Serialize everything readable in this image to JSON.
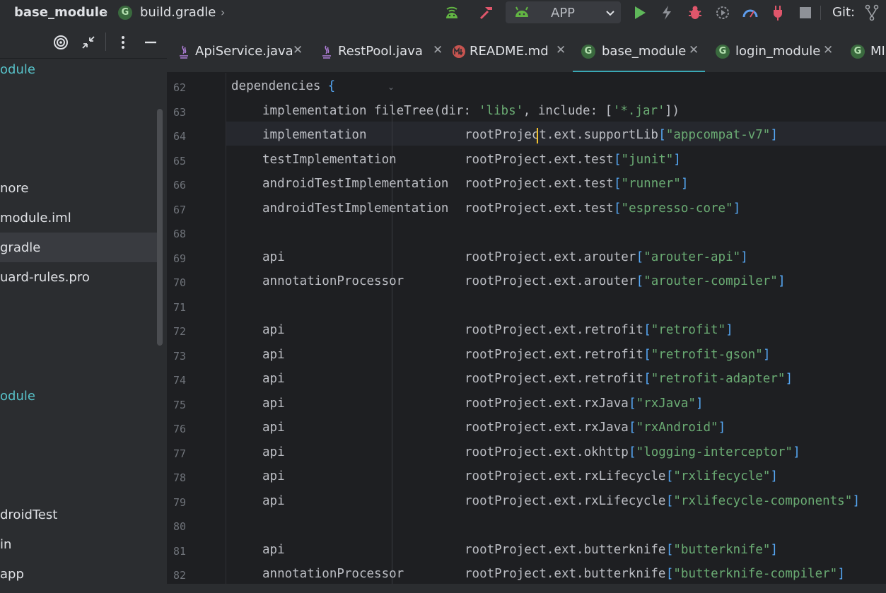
{
  "toolbar": {
    "breadcrumb_module": "base_module",
    "breadcrumb_file": "build.gradle",
    "run_config": "APP",
    "git_label": "Git:"
  },
  "project_panel": {
    "items": [
      {
        "label": "odule",
        "type": "module"
      },
      {
        "label": "nore",
        "type": "file"
      },
      {
        "label": "module.iml",
        "type": "file"
      },
      {
        "label": "gradle",
        "type": "file"
      },
      {
        "label": "uard-rules.pro",
        "type": "file"
      },
      {
        "label": "odule",
        "type": "module"
      },
      {
        "label": "droidTest",
        "type": "folder"
      },
      {
        "label": "in",
        "type": "folder"
      },
      {
        "label": "app",
        "type": "folder"
      }
    ]
  },
  "tabs": [
    {
      "label": "ApiService.java",
      "icon": "java-icon"
    },
    {
      "label": "RestPool.java",
      "icon": "java-icon"
    },
    {
      "label": "README.md",
      "icon": "markdown-icon"
    },
    {
      "label": "base_module",
      "icon": "gradle-icon",
      "active": true
    },
    {
      "label": "login_module",
      "icon": "gradle-icon"
    },
    {
      "label": "MI",
      "icon": "gradle-icon"
    }
  ],
  "editor": {
    "lines": [
      {
        "num": "62",
        "decl": "dependencies",
        "value": "",
        "key": "",
        "extra": "{"
      },
      {
        "num": "63",
        "decl": "implementation fileTree(dir: 'libs', include: ['*.jar'])",
        "value": "",
        "key": ""
      },
      {
        "num": "64",
        "decl": "implementation",
        "value": "rootProject.ext.supportLib",
        "key": "\"appcompat-v7\""
      },
      {
        "num": "65",
        "decl": "testImplementation",
        "value": "rootProject.ext.test",
        "key": "\"junit\""
      },
      {
        "num": "66",
        "decl": "androidTestImplementation",
        "value": "rootProject.ext.test",
        "key": "\"runner\""
      },
      {
        "num": "67",
        "decl": "androidTestImplementation",
        "value": "rootProject.ext.test",
        "key": "\"espresso-core\""
      },
      {
        "num": "68",
        "decl": "",
        "value": "",
        "key": ""
      },
      {
        "num": "69",
        "decl": "api",
        "value": "rootProject.ext.arouter",
        "key": "\"arouter-api\""
      },
      {
        "num": "70",
        "decl": "annotationProcessor",
        "value": "rootProject.ext.arouter",
        "key": "\"arouter-compiler\""
      },
      {
        "num": "71",
        "decl": "",
        "value": "",
        "key": ""
      },
      {
        "num": "72",
        "decl": "api",
        "value": "rootProject.ext.retrofit",
        "key": "\"retrofit\""
      },
      {
        "num": "73",
        "decl": "api",
        "value": "rootProject.ext.retrofit",
        "key": "\"retrofit-gson\""
      },
      {
        "num": "74",
        "decl": "api",
        "value": "rootProject.ext.retrofit",
        "key": "\"retrofit-adapter\""
      },
      {
        "num": "75",
        "decl": "api",
        "value": "rootProject.ext.rxJava",
        "key": "\"rxJava\""
      },
      {
        "num": "76",
        "decl": "api",
        "value": "rootProject.ext.rxJava",
        "key": "\"rxAndroid\""
      },
      {
        "num": "77",
        "decl": "api",
        "value": "rootProject.ext.okhttp",
        "key": "\"logging-interceptor\""
      },
      {
        "num": "78",
        "decl": "api",
        "value": "rootProject.ext.rxLifecycle",
        "key": "\"rxlifecycle\""
      },
      {
        "num": "79",
        "decl": "api",
        "value": "rootProject.ext.rxLifecycle",
        "key": "\"rxlifecycle-components\""
      },
      {
        "num": "80",
        "decl": "",
        "value": "",
        "key": ""
      },
      {
        "num": "81",
        "decl": "api",
        "value": "rootProject.ext.butterknife",
        "key": "\"butterknife\""
      },
      {
        "num": "82",
        "decl": "annotationProcessor",
        "value": "rootProject.ext.butterknife",
        "key": "\"butterknife-compiler\""
      }
    ]
  },
  "colors": {
    "accent": "#3aa8b5",
    "string": "#6aab73",
    "module": "#57c2c9",
    "caret": "#f0c030"
  }
}
